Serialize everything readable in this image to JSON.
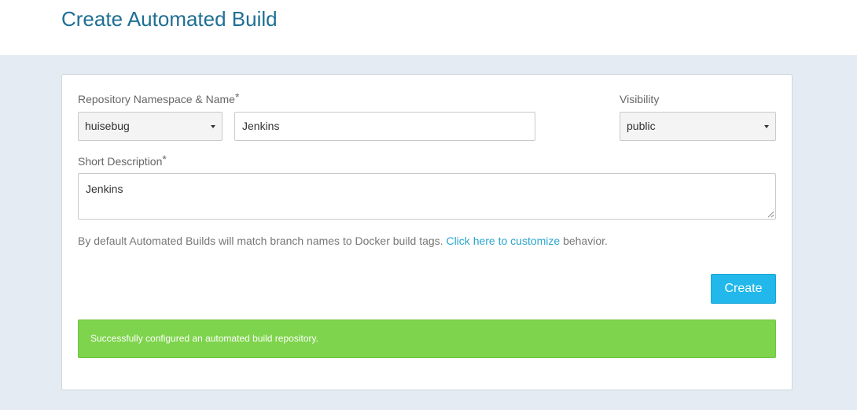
{
  "page": {
    "title": "Create Automated Build"
  },
  "form": {
    "repo_label": "Repository Namespace & Name",
    "required_mark": "*",
    "namespace_value": "huisebug",
    "name_value": "Jenkins",
    "visibility_label": "Visibility",
    "visibility_value": "public",
    "description_label": "Short Description",
    "description_value": "Jenkins",
    "help_text_before": "By default Automated Builds will match branch names to Docker build tags.",
    "help_link": "Click here to customize",
    "help_text_after": "behavior.",
    "create_label": "Create"
  },
  "alert": {
    "message": "Successfully configured an automated build repository.",
    "color": "#7ed44c"
  },
  "colors": {
    "title": "#1f6f93",
    "link": "#2ba6cb",
    "button": "#22b8eb",
    "background": "#e5ebf3"
  }
}
